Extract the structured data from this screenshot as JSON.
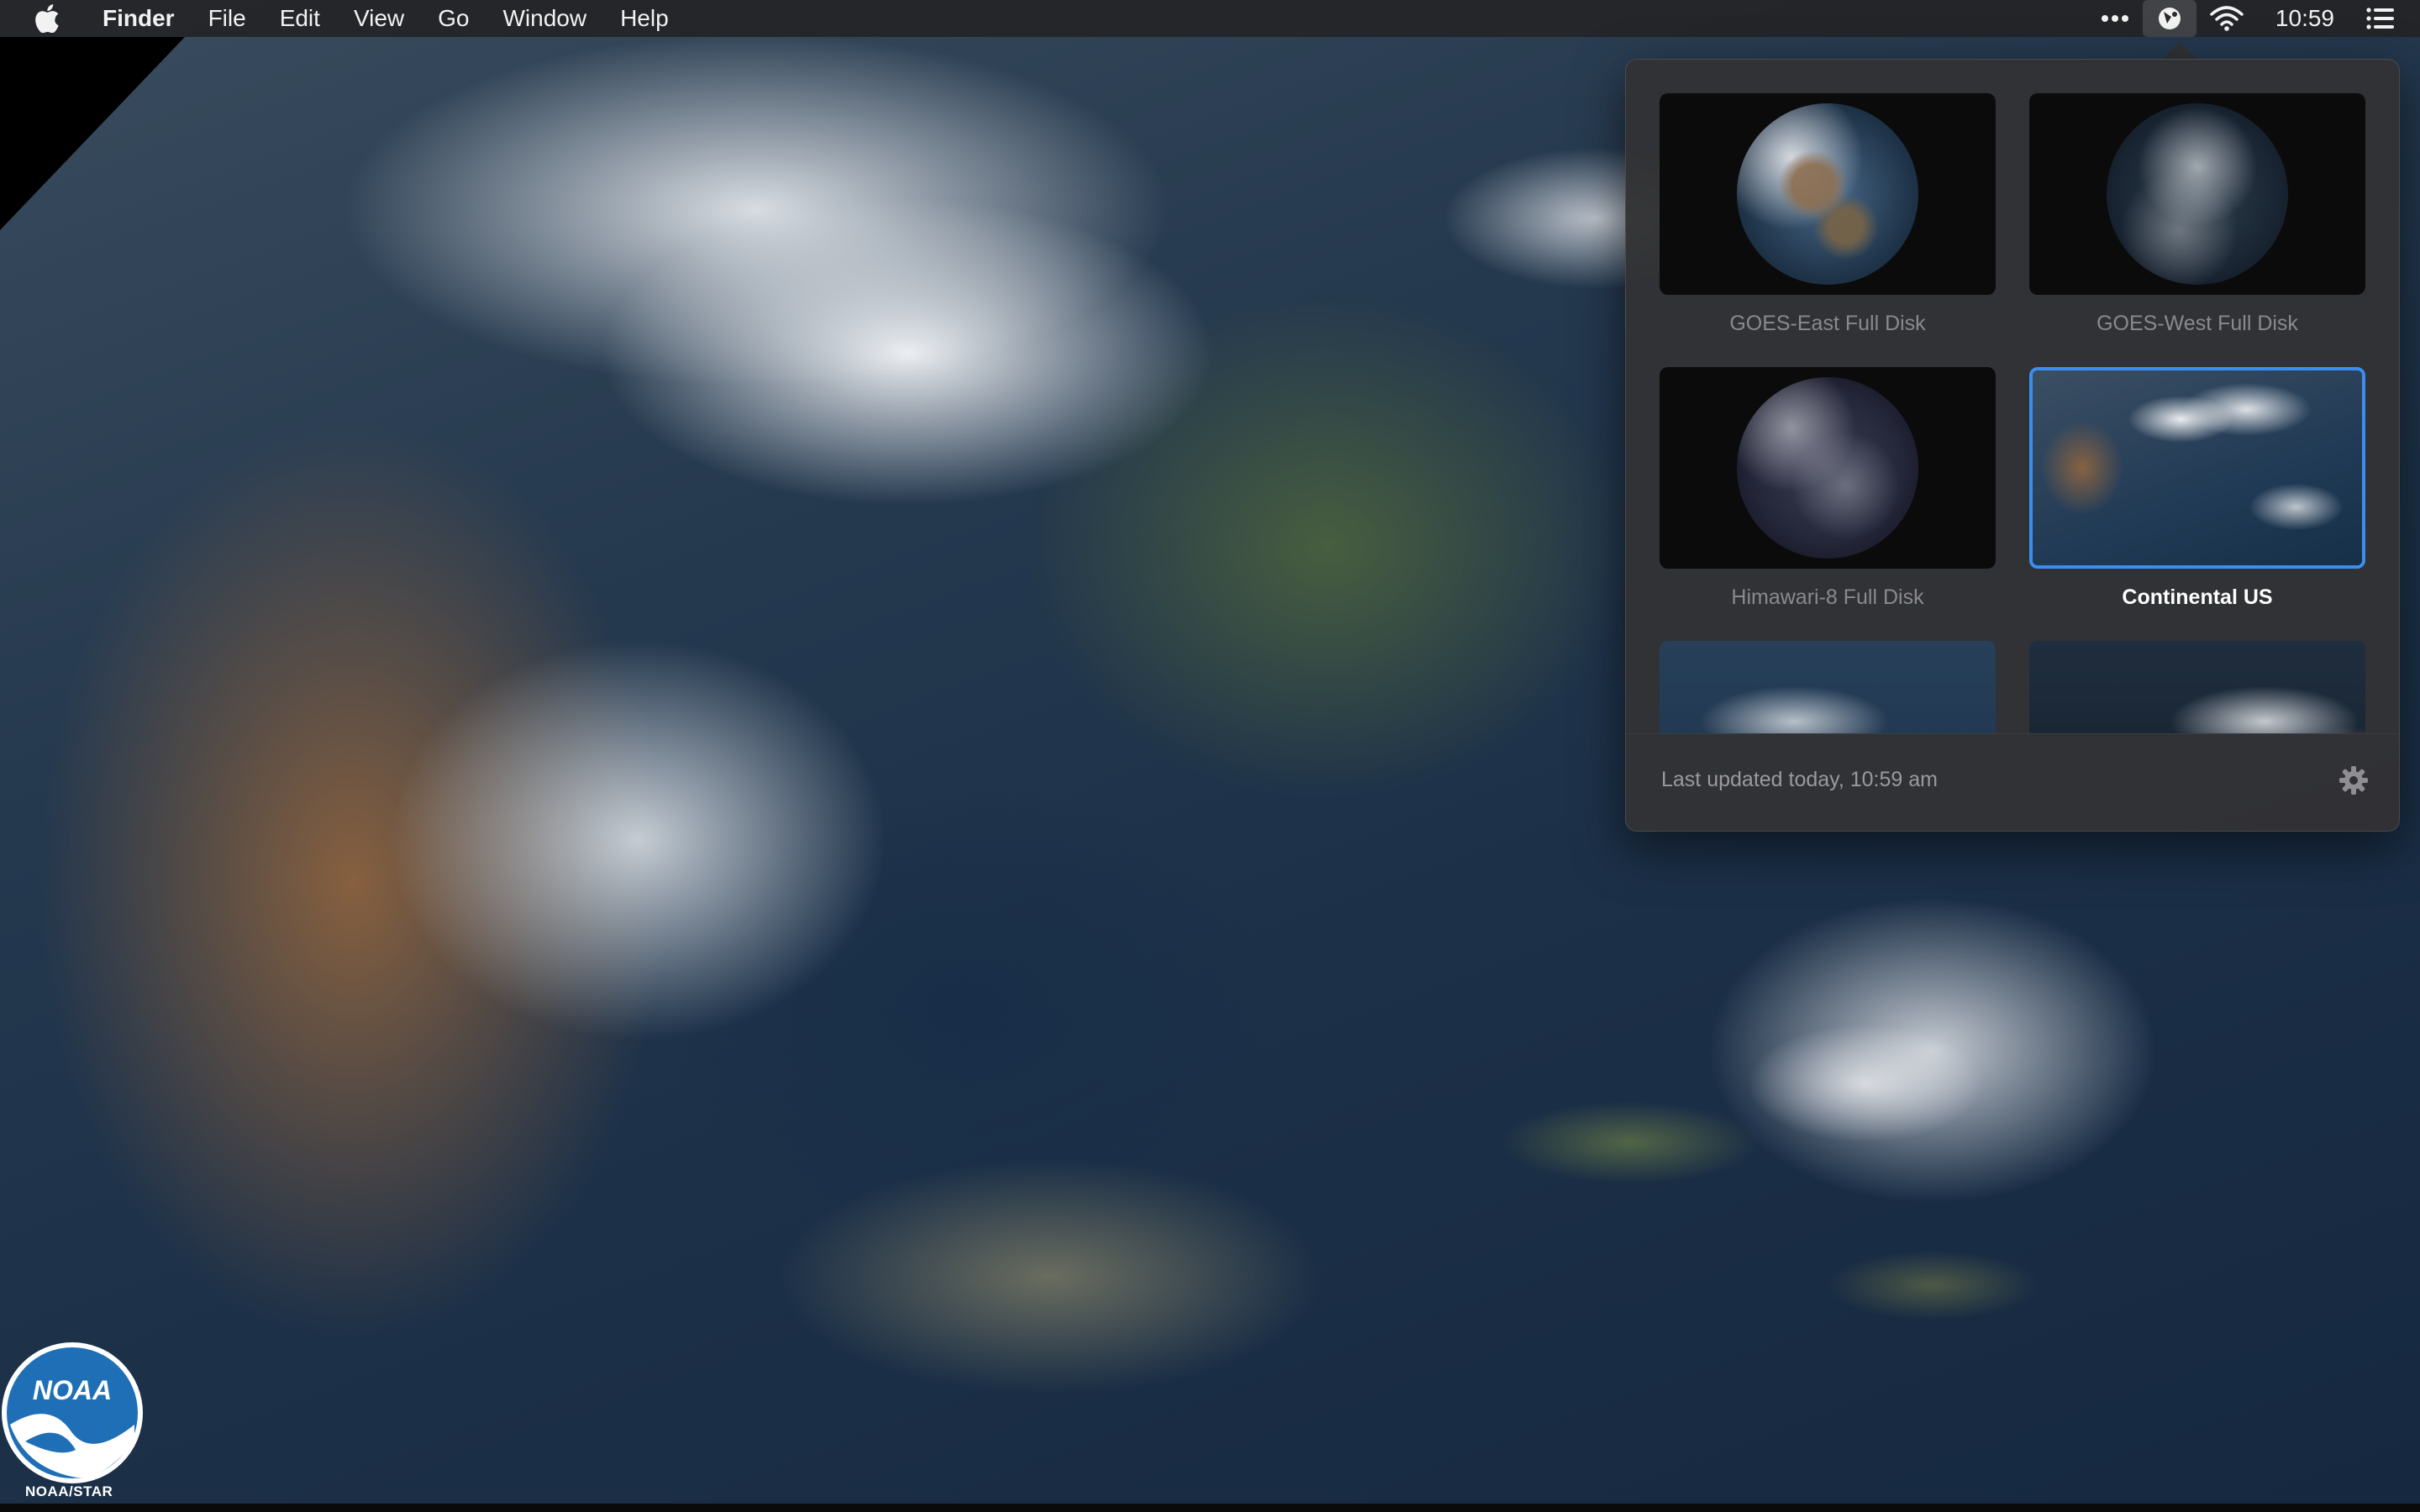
{
  "menubar": {
    "apple": "apple-logo",
    "app_name": "Finder",
    "items": [
      "File",
      "Edit",
      "View",
      "Go",
      "Window",
      "Help"
    ],
    "status_icons": [
      "more-icon",
      "satellite-app-icon",
      "wifi-icon"
    ],
    "clock": "10:59"
  },
  "popover": {
    "thumbnails": [
      {
        "label": "GOES-East Full Disk",
        "selected": false
      },
      {
        "label": "GOES-West Full Disk",
        "selected": false
      },
      {
        "label": "Himawari-8 Full Disk",
        "selected": false
      },
      {
        "label": "Continental US",
        "selected": true
      },
      {
        "label": "",
        "selected": false
      },
      {
        "label": "",
        "selected": false
      }
    ],
    "last_updated": "Last updated today, 10:59 am",
    "accent_color": "#3b8ef0"
  },
  "wallpaper": {
    "logo_text": "NOAA",
    "logo_caption": "NOAA/STAR"
  }
}
